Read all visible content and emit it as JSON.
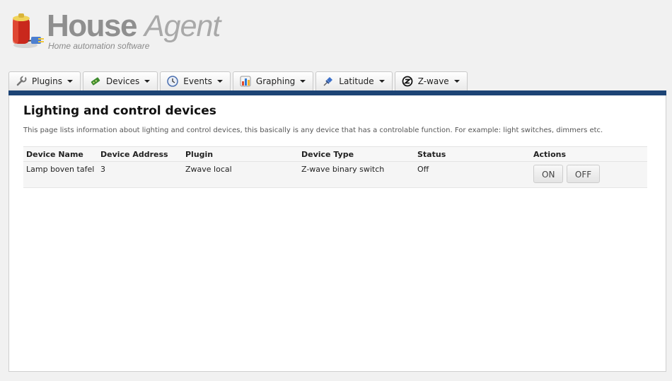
{
  "header": {
    "logo_word_1": "House",
    "logo_word_2": "Agent",
    "tagline": "Home automation software"
  },
  "nav": {
    "tabs": [
      {
        "label": "Plugins",
        "icon": "wrench-icon"
      },
      {
        "label": "Devices",
        "icon": "circuit-board-icon"
      },
      {
        "label": "Events",
        "icon": "clock-icon"
      },
      {
        "label": "Graphing",
        "icon": "chart-icon"
      },
      {
        "label": "Latitude",
        "icon": "pushpin-icon"
      },
      {
        "label": "Z-wave",
        "icon": "zwave-icon"
      }
    ]
  },
  "colors": {
    "nav_bar": "#1d4475"
  },
  "main": {
    "title": "Lighting and control devices",
    "description": "This page lists information about lighting and control devices, this basically is any device that has a controlable function. For example: light switches, dimmers etc.",
    "table": {
      "columns": [
        "Device Name",
        "Device Address",
        "Plugin",
        "Device Type",
        "Status",
        "Actions"
      ],
      "rows": [
        {
          "device_name": "Lamp boven tafel",
          "device_address": "3",
          "plugin": "Zwave local",
          "device_type": "Z-wave binary switch",
          "status": "Off",
          "actions": [
            "ON",
            "OFF"
          ]
        }
      ]
    }
  }
}
